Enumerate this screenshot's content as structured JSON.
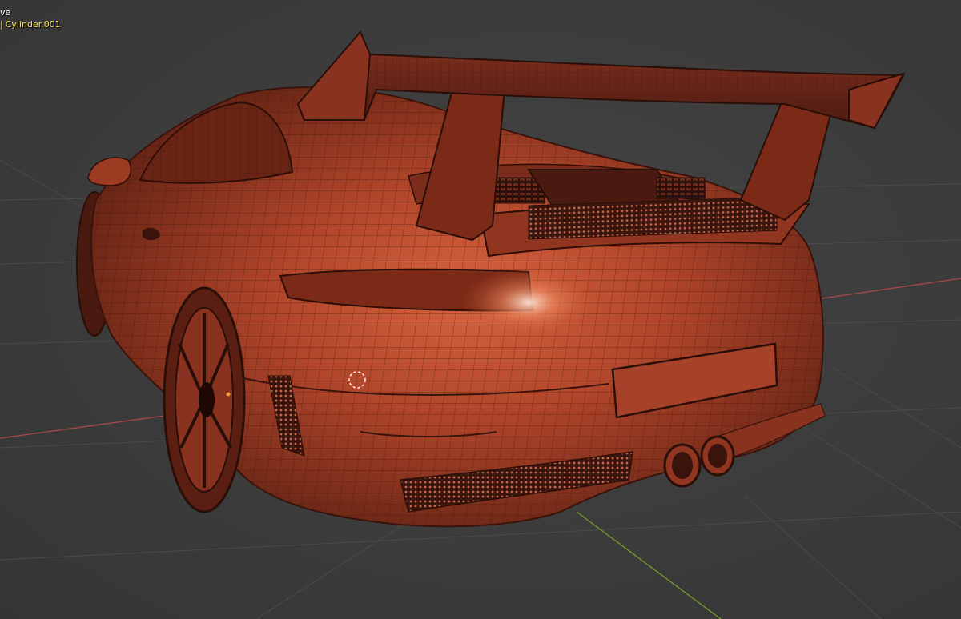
{
  "viewport": {
    "mode_text": "ve",
    "object_separator": "|",
    "object_name": "Cylinder.001",
    "colors": {
      "background": "#3d3d3d",
      "grid": "#4a4a4a",
      "x_axis": "#a84848",
      "y_axis": "#6f9e2a",
      "mesh_body": "#b5472c",
      "mesh_wire": "#3a140c",
      "object_text": "#f2e44a"
    }
  }
}
